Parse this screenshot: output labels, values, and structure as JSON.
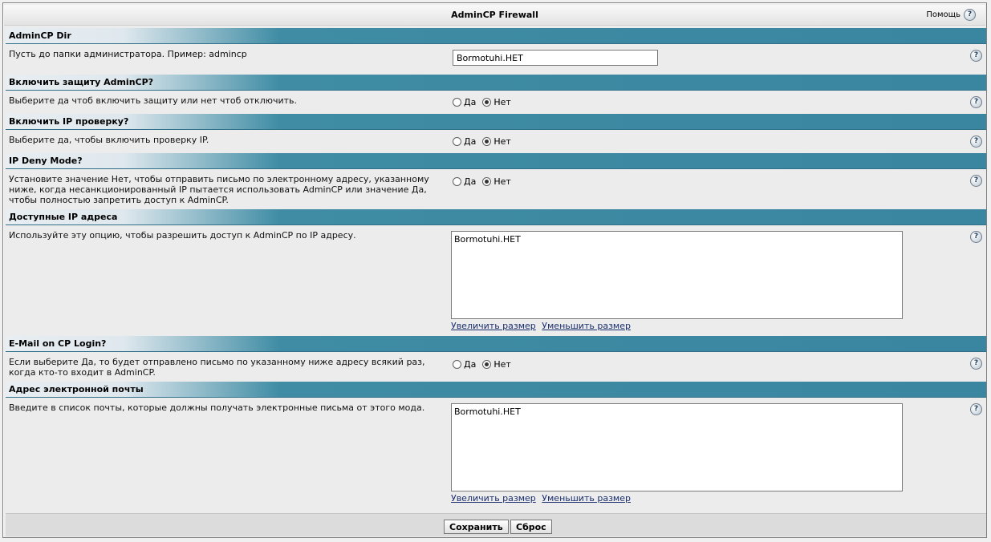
{
  "window": {
    "title": "AdminCP Firewall",
    "help_label": "Помощь"
  },
  "sections": [
    {
      "head": "AdminCP Dir",
      "desc": "Пусть до папки администратора. Пример: admincp",
      "value": "Bormotuhi.HET"
    },
    {
      "head": "Включить защиту AdminCP?",
      "desc": "Выберите да чтоб включить защиту или нет чтоб отключить.",
      "yes": "Да",
      "no": "Нет",
      "selected": "no"
    },
    {
      "head": "Включить IP проверку?",
      "desc": "Выберите да, чтобы включить проверку IP.",
      "yes": "Да",
      "no": "Нет",
      "selected": "no"
    },
    {
      "head": "IP Deny Mode?",
      "desc": "Установите значение Нет, чтобы отправить письмо по электронному адресу, указанному ниже, когда несанкционированный IP пытается использовать AdminCP или значение Да, чтобы полностью запретить доступ к AdminCP.",
      "yes": "Да",
      "no": "Нет",
      "selected": "no"
    },
    {
      "head": "Доступные IP адреса",
      "desc": "Используйте эту опцию, чтобы разрешить доступ к AdminCP по IP адресу.",
      "value": "Bormotuhi.HET",
      "enlarge": "Увеличить размер",
      "shrink": "Уменьшить размер"
    },
    {
      "head": "E-Mail on CP Login?",
      "desc": "Если выберите Да, то будет отправлено письмо по указанному ниже адресу всякий раз, когда кто-то входит в AdminCP.",
      "yes": "Да",
      "no": "Нет",
      "selected": "no"
    },
    {
      "head": "Адрес электронной почты",
      "desc": "Введите в список почты, которые должны получать электронные письма от этого мода.",
      "value": "Bormotuhi.HET",
      "enlarge": "Увеличить размер",
      "shrink": "Уменьшить размер"
    }
  ],
  "footer": {
    "save": "Сохранить",
    "reset": "Сброс"
  }
}
